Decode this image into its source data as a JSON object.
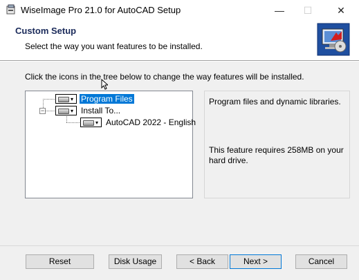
{
  "window": {
    "title": "WiseImage Pro 21.0 for AutoCAD Setup",
    "minimize_glyph": "—",
    "maximize_glyph": "☐",
    "close_glyph": "✕"
  },
  "header": {
    "title": "Custom Setup",
    "subtitle": "Select the way you want features to be installed."
  },
  "instruction": "Click the icons in the tree below to change the way features will be installed.",
  "tree": {
    "items": [
      {
        "label": "Program Files",
        "selected": true,
        "icon": "drive-icon"
      },
      {
        "label": "Install To...",
        "selected": false,
        "icon": "drive-icon"
      },
      {
        "label": "AutoCAD 2022 - English",
        "selected": false,
        "icon": "drive-icon"
      }
    ],
    "dropdown_glyph": "▾",
    "collapse_glyph": "−"
  },
  "description": {
    "text": "Program files and dynamic libraries.",
    "requirement": "This feature requires 258MB on your hard drive."
  },
  "buttons": {
    "reset": "Reset",
    "disk_usage": "Disk Usage",
    "back": "< Back",
    "next": "Next >",
    "cancel": "Cancel"
  },
  "colors": {
    "selection": "#0078d7",
    "header_title": "#1a2a5a"
  }
}
